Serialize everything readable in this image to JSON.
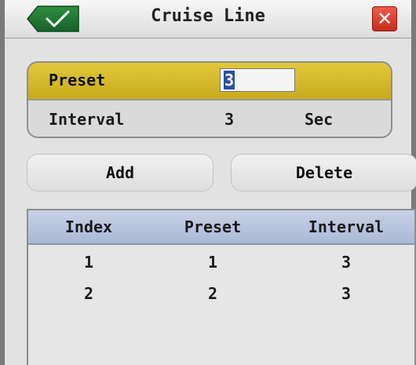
{
  "dialog": {
    "title": "Cruise Line",
    "ok_icon": "checkmark-icon",
    "close_icon": "close-x-icon",
    "close_glyph": "✕",
    "accent": "#d2b62a",
    "header_bg": "#b3c1da"
  },
  "params": {
    "preset_label": "Preset",
    "preset_value": "3",
    "interval_label": "Interval",
    "interval_value": "3",
    "interval_unit": "Sec"
  },
  "actions": {
    "add_label": "Add",
    "delete_label": "Delete"
  },
  "table": {
    "headers": [
      "Index",
      "Preset",
      "Interval"
    ],
    "rows": [
      [
        "1",
        "1",
        "3"
      ],
      [
        "2",
        "2",
        "3"
      ]
    ]
  }
}
